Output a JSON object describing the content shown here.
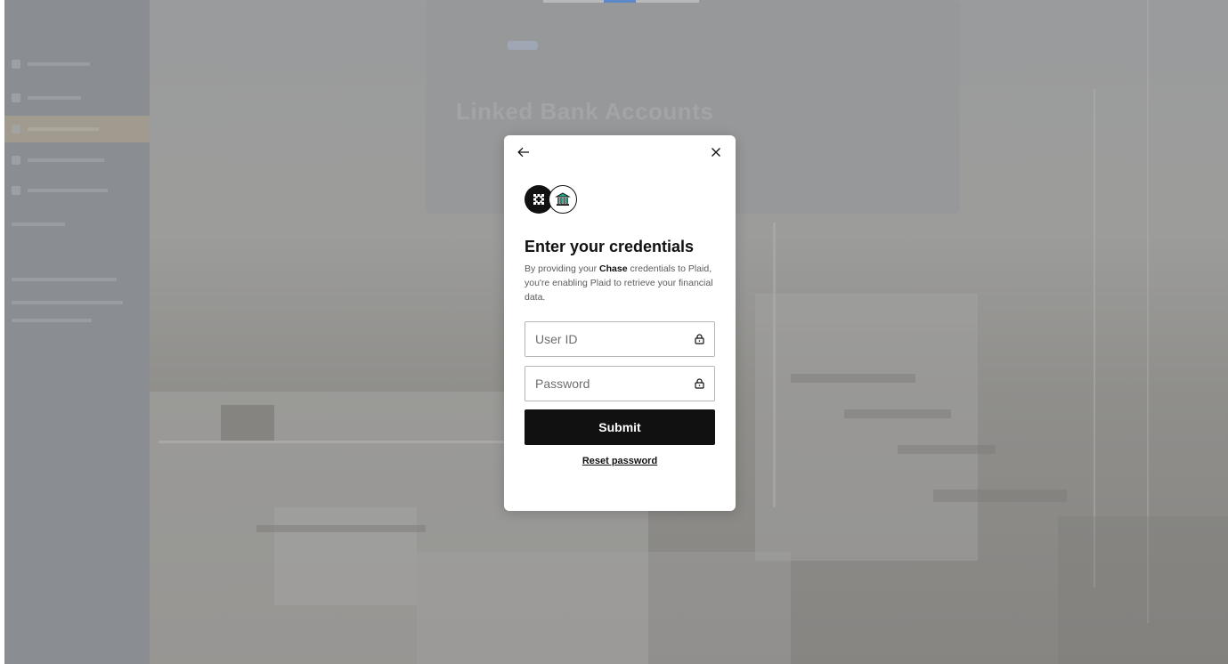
{
  "background": {
    "heading": "Linked Bank Accounts"
  },
  "modal": {
    "title": "Enter your credentials",
    "description_prefix": "By providing your ",
    "institution": "Chase",
    "description_suffix": " credentials to Plaid, you're enabling Plaid to retrieve your financial data.",
    "user_id_placeholder": "User ID",
    "password_placeholder": "Password",
    "submit_label": "Submit",
    "reset_label": "Reset password",
    "icons": {
      "back": "arrow-left-icon",
      "close": "close-icon",
      "plaid": "plaid-logo-icon",
      "bank": "bank-building-icon",
      "lock": "lock-icon"
    },
    "colors": {
      "primary": "#111111",
      "bank_accent": "#1bb08a"
    }
  }
}
